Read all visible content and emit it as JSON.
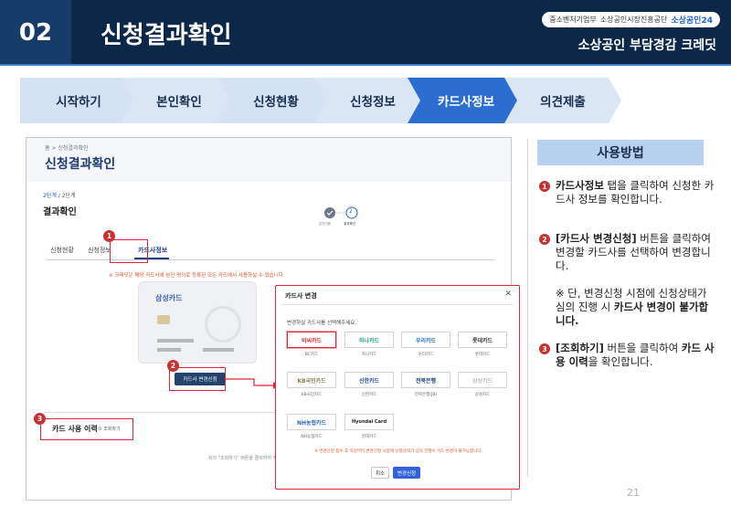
{
  "header": {
    "number": "02",
    "title": "신청결과확인",
    "logo_1": "중소벤처기업부",
    "logo_2": "소상공인시장진흥공단",
    "logo_3": "소상공인24",
    "brand": "소상공인 부담경감 크레딧"
  },
  "steps": [
    {
      "label": "시작하기",
      "active": false
    },
    {
      "label": "본인확인",
      "active": false
    },
    {
      "label": "신청현황",
      "active": false
    },
    {
      "label": "신청정보",
      "active": false
    },
    {
      "label": "카드사정보",
      "active": true
    },
    {
      "label": "의견제출",
      "active": false
    }
  ],
  "screen": {
    "breadcrumb": "홈 > 신청결과확인",
    "title": "신청결과확인",
    "stage_current": "2단계",
    "stage_total": "/ 2단계",
    "result_title": "결과확인",
    "progress_1_label": "본인인증",
    "progress_2_label": "결과확인",
    "progress_2_num": "2",
    "tabs": [
      "신청현황",
      "신청정보",
      "카드사정보"
    ],
    "notice": "※ 크레딧은 해당 카드사에 본인 명의로 등록된 모든 카드에서 사용하실 수 있습니다.",
    "card_name": "삼성카드",
    "change_button": "카드사 변경신청",
    "usage_title": "카드 사용 이력",
    "lookup_button": "조회하기",
    "hint": "위의 \"조회하기\" 버튼을 클릭하여 카드 사용 이력을 확인하세요."
  },
  "badges": [
    "1",
    "2",
    "3"
  ],
  "modal": {
    "title": "카드사 변경",
    "close": "✕",
    "subtitle": "변경하실 카드사를 선택해주세요.",
    "options": [
      {
        "name": "비씨카드",
        "label": "BC카드",
        "color": "#e1262d",
        "selected": true
      },
      {
        "name": "하나카드",
        "label": "하나카드",
        "color": "#1aa08a",
        "selected": false
      },
      {
        "name": "우리카드",
        "label": "우리카드",
        "color": "#1f6ec3",
        "selected": false
      },
      {
        "name": "롯데카드",
        "label": "롯데카드",
        "color": "#333333",
        "selected": false
      },
      {
        "name": "KB국민카드",
        "label": "KB국민카드",
        "color": "#8a7a55",
        "selected": false
      },
      {
        "name": "신한카드",
        "label": "신한카드",
        "color": "#1f47a8",
        "selected": false
      },
      {
        "name": "전북은행",
        "label": "전북은행(JB)",
        "color": "#1c3f7a",
        "selected": false
      },
      {
        "name": "삼성카드",
        "label": "삼성카드",
        "color": "#999999",
        "selected": false
      },
      {
        "name": "NH농협카드",
        "label": "NH농협카드",
        "color": "#2b67b5",
        "selected": false
      },
      {
        "name": "Hyundai Card",
        "label": "현대카드",
        "color": "#222222",
        "selected": false
      }
    ],
    "warning": "※ 변경신청 접수 후 익일부터 변경신청 시점에 신청상태가 심의 진행이 카드 변경이 불가능합니다.",
    "cancel": "취소",
    "apply": "변경신청"
  },
  "how_to": {
    "title": "사용방법",
    "items": [
      {
        "num": "1",
        "bold": "카드사정보",
        "rest": " 탭을 클릭하여 신청한 카드사 정보를 확인합니다."
      },
      {
        "num": "2",
        "bold": "[카드사 변경신청]",
        "rest": " 버튼을 클릭하여 변경할 카드사를 선택하여 변경합니다."
      },
      {
        "note": "※ 단, 변경신청 시점에 신청상태가 심의 진행 시 ",
        "note_bold": "카드사 변경이 불가합니다."
      },
      {
        "num": "3",
        "bold": "[조회하기]",
        "rest": " 버튼을 클릭하여 ",
        "bold2": "카드 사용 이력",
        "rest2": "을 확인합니다."
      }
    ]
  },
  "page_number": "21"
}
